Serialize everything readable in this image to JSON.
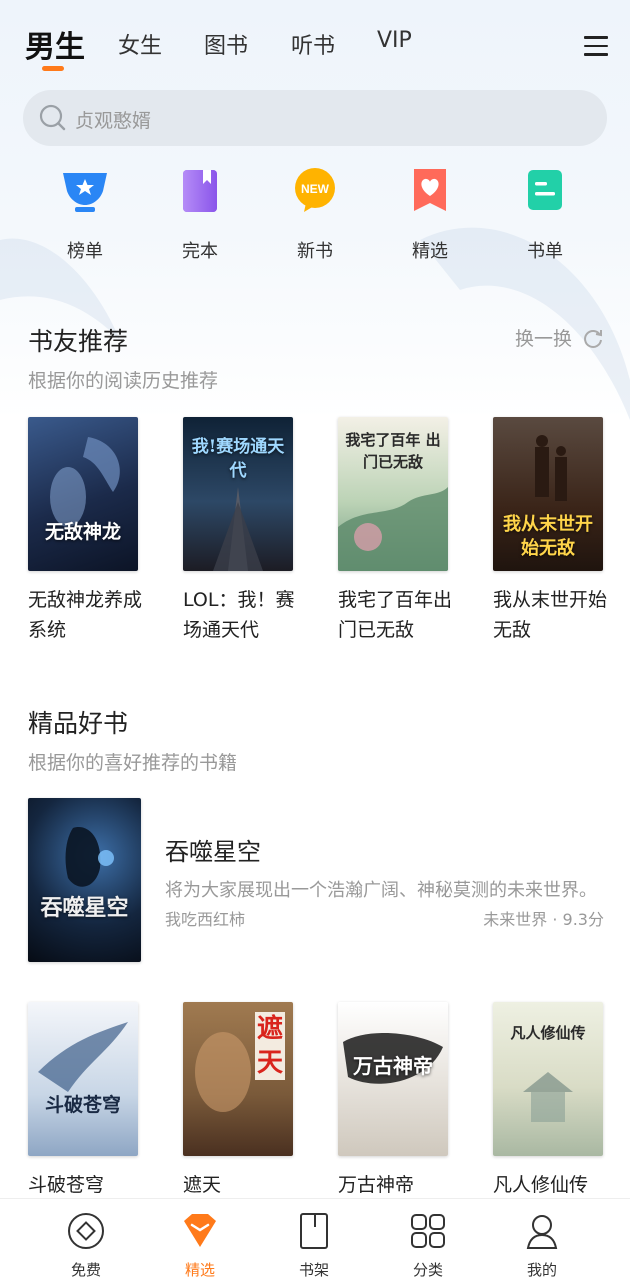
{
  "top_tabs": [
    "男生",
    "女生",
    "图书",
    "听书",
    "VIP"
  ],
  "search": {
    "placeholder": "贞观憨婿"
  },
  "shortcuts": [
    {
      "label": "榜单",
      "icon": "trophy-icon"
    },
    {
      "label": "完本",
      "icon": "book-bookmark-icon"
    },
    {
      "label": "新书",
      "icon": "new-badge-icon"
    },
    {
      "label": "精选",
      "icon": "heart-bookmark-icon"
    },
    {
      "label": "书单",
      "icon": "list-card-icon"
    }
  ],
  "friends_section": {
    "title": "书友推荐",
    "subtitle": "根据你的阅读历史推荐",
    "refresh_label": "换一换",
    "books": [
      {
        "name": "无敌神龙养成系统",
        "cover_text": "无敌神龙",
        "cover_color": "#1b2a4a"
      },
      {
        "name": "LOL：我！赛场通天代",
        "cover_text": "我!赛场通天代",
        "cover_color": "#1e3048"
      },
      {
        "name": "我宅了百年出门已无敌",
        "cover_text": "我宅了百年 出门已无敌",
        "cover_color": "#9bb59a"
      },
      {
        "name": "我从末世开始无敌",
        "cover_text": "我从末世开始无敌",
        "cover_color": "#3a2418"
      }
    ]
  },
  "quality_section": {
    "title": "精品好书",
    "subtitle": "根据你的喜好推荐的书籍",
    "featured": {
      "title": "吞噬星空",
      "description": "将为大家展现出一个浩瀚广阔、神秘莫测的未来世界。",
      "author": "我吃西红柿",
      "meta": "未来世界 · 9.3分",
      "cover_text": "吞噬星空",
      "cover_color": "#0e1a2c"
    },
    "books": [
      {
        "name": "斗破苍穹",
        "cover_text": "斗破苍穹",
        "cover_color": "#dfe6ef"
      },
      {
        "name": "遮天",
        "cover_text": "遮天",
        "cover_color": "#7a5a3a"
      },
      {
        "name": "万古神帝",
        "cover_text": "万古神帝",
        "cover_color": "#e8e4de"
      },
      {
        "name": "凡人修仙传",
        "cover_text": "凡人修仙传",
        "cover_color": "#d9dcc6"
      }
    ]
  },
  "bottom_nav": [
    {
      "label": "免费",
      "icon": "free-coin-icon"
    },
    {
      "label": "精选",
      "icon": "diamond-icon"
    },
    {
      "label": "书架",
      "icon": "bookshelf-icon"
    },
    {
      "label": "分类",
      "icon": "grid-icon"
    },
    {
      "label": "我的",
      "icon": "profile-icon"
    }
  ],
  "colors": {
    "accent": "#ff7a1a",
    "search_bg": "#e3e8ee"
  }
}
